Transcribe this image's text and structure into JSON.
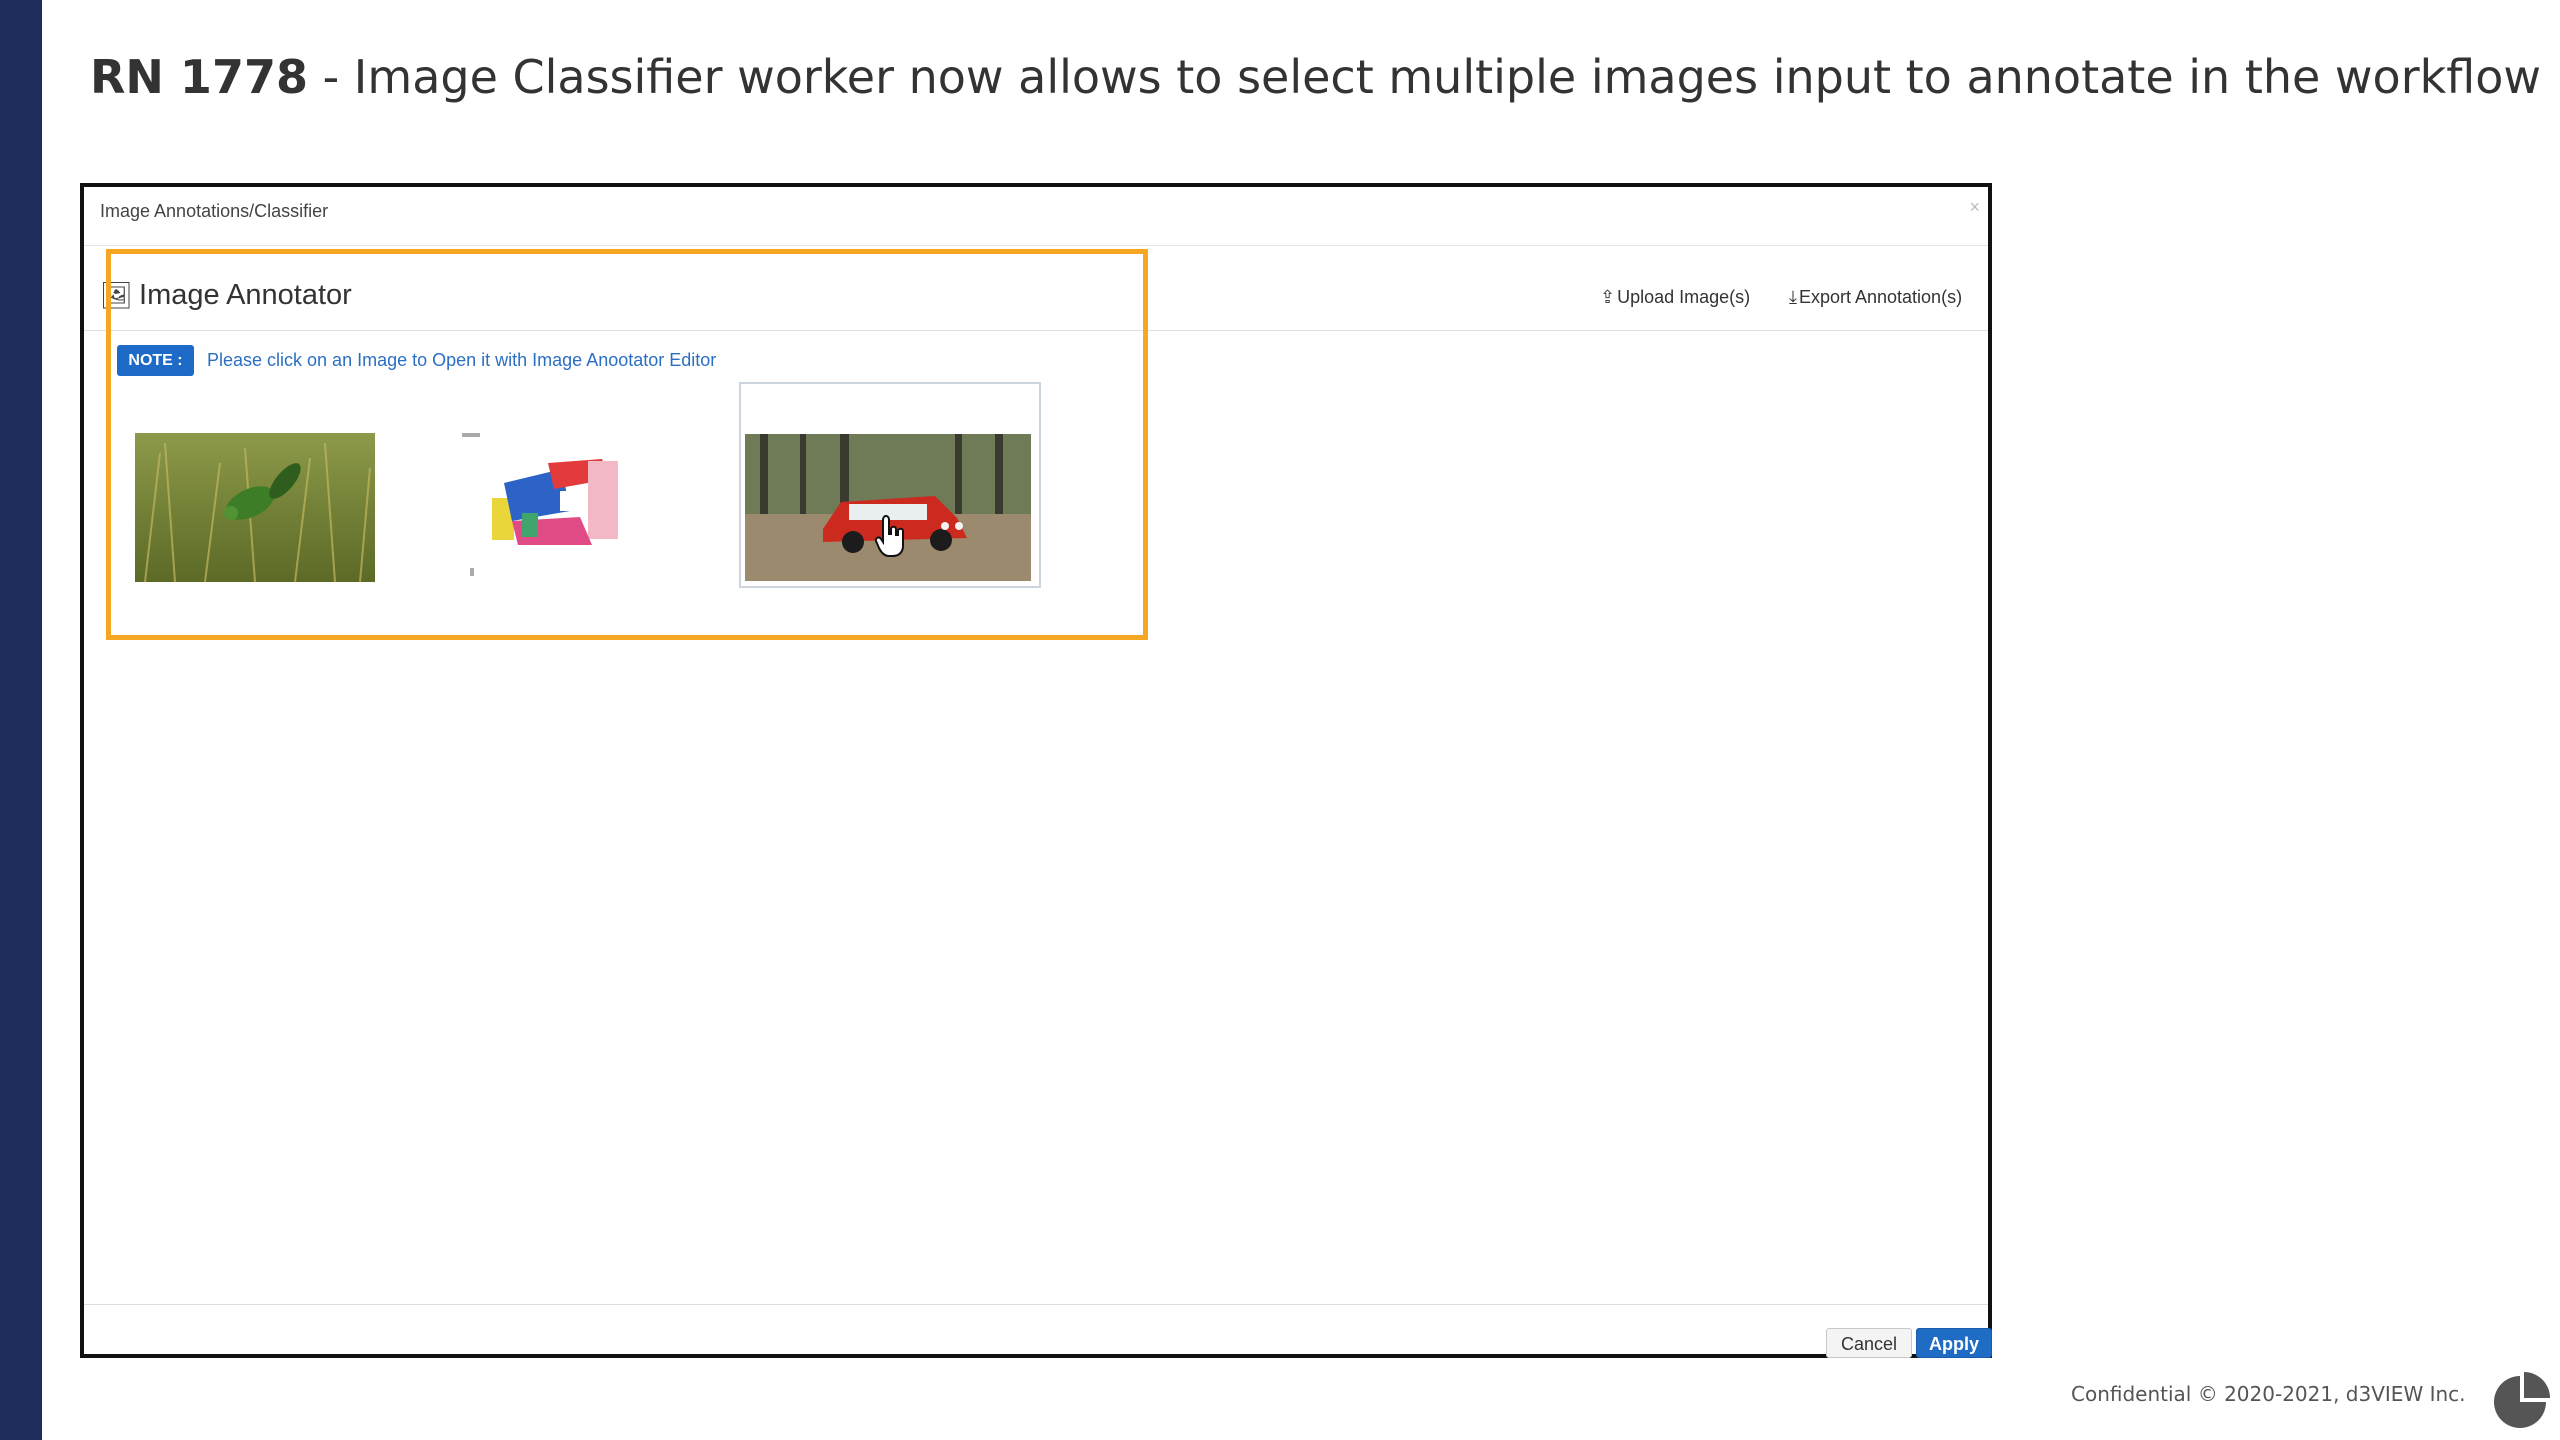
{
  "slide": {
    "rn_label": "RN 1778",
    "title_rest": " - Image Classifier worker now allows to select multiple images input to annotate in the workflow",
    "footer": "Confidential © 2020-2021,  d3VIEW Inc."
  },
  "dialog": {
    "title": "Image Annotations/Classifier",
    "close_symbol": "×",
    "panel_title": "Image Annotator",
    "upload_label": "Upload Image(s)",
    "export_label": "Export Annotation(s)",
    "note_badge": "NOTE :",
    "note_text": "Please click on an Image to Open it with Image Anootator Editor",
    "cancel_label": "Cancel",
    "apply_label": "Apply"
  },
  "icons": {
    "panel": "image-icon",
    "upload": "upload-icon",
    "export": "download-icon",
    "cursor": "hand-pointer-icon",
    "logo": "pie-logo-icon"
  },
  "colors": {
    "sidebar": "#1f2d5c",
    "highlight": "#f5a623",
    "primary": "#1f6cc5",
    "note_text": "#2b6fc4"
  }
}
